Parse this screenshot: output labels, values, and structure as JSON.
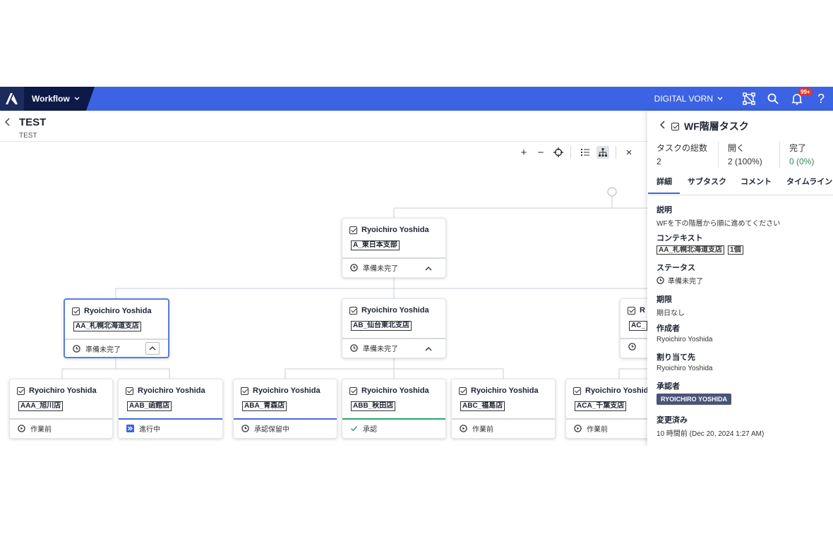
{
  "topbar": {
    "module": "Workflow",
    "tenant": "DIGITAL VORN",
    "notif_count": "99+",
    "help": "?"
  },
  "page": {
    "title": "TEST",
    "subtitle": "TEST"
  },
  "toolbar": {
    "plus": "+",
    "minus": "−",
    "close": "×"
  },
  "nodes": {
    "a": {
      "name": "Ryoichiro Yoshida",
      "context": "A_東日本支部",
      "status": "準備未完了"
    },
    "aa": {
      "name": "Ryoichiro Yoshida",
      "context": "AA_札幌北海道支店",
      "status": "準備未完了"
    },
    "ab": {
      "name": "Ryoichiro Yoshida",
      "context": "AB_仙台東北支店",
      "status": "準備未完了"
    },
    "ac": {
      "name": "R",
      "context": "AC_",
      "status": ""
    },
    "aaa": {
      "name": "Ryoichiro Yoshida",
      "context": "AAA_旭川店",
      "status": "作業前"
    },
    "aab": {
      "name": "Ryoichiro Yoshida",
      "context": "AAB_函館店",
      "status": "進行中"
    },
    "aba": {
      "name": "Ryoichiro Yoshida",
      "context": "ABA_青森店",
      "status": "承認保留中"
    },
    "abb": {
      "name": "Ryoichiro Yoshida",
      "context": "ABB_秋田店",
      "status": "承認"
    },
    "abc": {
      "name": "Ryoichiro Yoshida",
      "context": "ABC_福島店",
      "status": "作業前"
    },
    "aca": {
      "name": "Ryoichiro Yoshida",
      "context": "ACA_千葉支店",
      "status": "作業前"
    }
  },
  "panel": {
    "title": "WF階層タスク",
    "stats": {
      "total_label": "タスクの総数",
      "total_value": "2",
      "open_label": "開く",
      "open_value": "2 (100%)",
      "done_label": "完了",
      "done_value": "0 (0%)"
    },
    "tabs": [
      "詳細",
      "サブタスク",
      "コメント",
      "タイムライン"
    ],
    "desc_label": "説明",
    "desc_value": "WFを下の階層から順に進めてください",
    "context_label": "コンテキスト",
    "context_tag": "AA_札幌北海道支店",
    "context_count": "1個",
    "status_label": "ステータス",
    "status_value": "準備未完了",
    "due_label": "期限",
    "due_value": "期日なし",
    "creator_label": "作成者",
    "creator_value": "Ryoichiro Yoshida",
    "assignee_label": "割り当て先",
    "assignee_value": "Ryoichiro Yoshida",
    "approver_label": "承認者",
    "approver_value": "RYOICHIRO YOSHIDA",
    "modified_label": "変更済み",
    "modified_value": "10 時間前 (Dec 20, 2024 1:27 AM)"
  },
  "colors": {
    "brand": "#3b63e3",
    "module_bg": "#0d1a47",
    "approved": "#2ea66e",
    "in_progress": "#4a6ad7",
    "badge": "#e5352c"
  }
}
